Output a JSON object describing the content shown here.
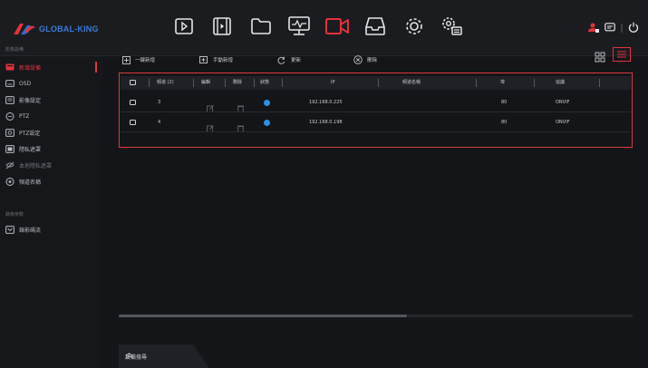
{
  "app": {
    "logo_text": "GLOBAL-KING"
  },
  "top_nav": {
    "icons": [
      "playback-icon",
      "video-clip-icon",
      "folder-icon",
      "network-icon",
      "camera-icon",
      "storage-icon",
      "settings-icon",
      "system-settings-icon"
    ],
    "active": "camera-icon"
  },
  "top_right": {
    "icons": [
      "user-icon",
      "messages-icon",
      "power-icon"
    ]
  },
  "sidebar": {
    "section1_title": "影像設備",
    "items": [
      {
        "label": "新增設備",
        "icon": "camera-add-icon",
        "active": true
      },
      {
        "label": "OSD",
        "icon": "osd-icon"
      },
      {
        "label": "影像設定",
        "icon": "image-settings-icon"
      },
      {
        "label": "PTZ",
        "icon": "ptz-icon"
      },
      {
        "label": "PTZ設定",
        "icon": "ptz-settings-icon"
      },
      {
        "label": "隱私遮罩",
        "icon": "privacy-mask-icon"
      },
      {
        "label": "本地隱私遮罩",
        "icon": "local-privacy-mask-icon",
        "dim": true
      },
      {
        "label": "頻道名稱",
        "icon": "channel-name-icon"
      }
    ],
    "section2_title": "錄像參數",
    "items2": [
      {
        "label": "錄影碼流",
        "icon": "record-stream-icon"
      }
    ]
  },
  "toolbar": {
    "quick_add": "一鍵新增",
    "manual_add": "手動新增",
    "refresh": "更新",
    "delete": "刪除"
  },
  "table": {
    "headers": {
      "channel": "頻道 (2)",
      "edit": "編輯",
      "delete": "刪除",
      "status": "狀態",
      "ip": "IP",
      "channel_name": "頻道名稱",
      "port": "埠",
      "protocol": "協議"
    },
    "rows": [
      {
        "channel": "3",
        "ip": "192.168.0.225",
        "channel_name": "",
        "port": "80",
        "protocol": "ONVIF",
        "status_color": "#2f8fe6"
      },
      {
        "channel": "4",
        "ip": "192.168.0.198",
        "channel_name": "",
        "port": "80",
        "protocol": "ONVIF",
        "status_color": "#2f8fe6"
      }
    ]
  },
  "bottom": {
    "device_search": "設備搜尋"
  },
  "colors": {
    "accent": "#e0343b",
    "status_online": "#2f8fe6",
    "brand": "#3a7bd5"
  }
}
